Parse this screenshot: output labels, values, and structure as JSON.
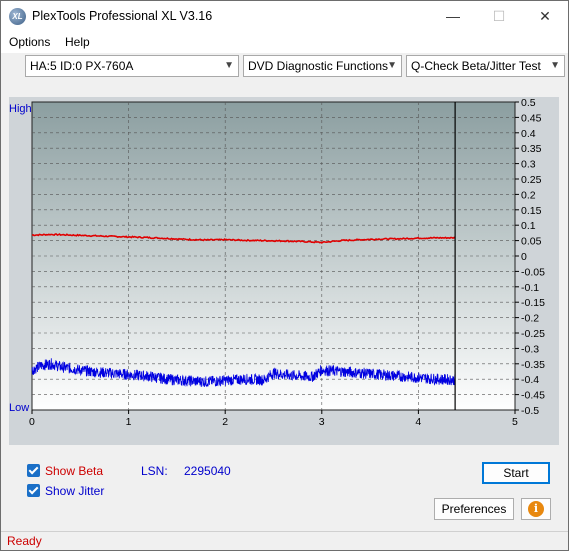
{
  "window": {
    "title": "PlexTools Professional XL V3.16",
    "icon_text": "XL"
  },
  "menu": {
    "options": "Options",
    "help": "Help"
  },
  "toolbar": {
    "drive": "HA:5 ID:0  PX-760A",
    "function": "DVD Diagnostic Functions",
    "test": "Q-Check Beta/Jitter Test"
  },
  "chart_data": {
    "type": "line",
    "y_axis_left_top": "High",
    "y_axis_left_bottom": "Low",
    "x_ticks": [
      "0",
      "1",
      "2",
      "3",
      "4",
      "5"
    ],
    "xlim": [
      0,
      5
    ],
    "y_ticks": [
      "0.5",
      "0.45",
      "0.4",
      "0.35",
      "0.3",
      "0.25",
      "0.2",
      "0.15",
      "0.1",
      "0.05",
      "0",
      "-0.05",
      "-0.1",
      "-0.15",
      "-0.2",
      "-0.25",
      "-0.3",
      "-0.35",
      "-0.4",
      "-0.45",
      "-0.5"
    ],
    "ylim": [
      -0.5,
      0.5
    ],
    "end_marker_x": 4.38,
    "grid": true,
    "colors": {
      "beta": "#e00000",
      "jitter": "#0000e0"
    },
    "series": [
      {
        "key": "beta",
        "color": "#e00000",
        "x": [
          0,
          0.2,
          0.4,
          0.6,
          0.8,
          1.0,
          1.2,
          1.4,
          1.6,
          1.8,
          2.0,
          2.2,
          2.4,
          2.6,
          2.8,
          3.0,
          3.2,
          3.4,
          3.6,
          3.8,
          4.0,
          4.2,
          4.38
        ],
        "y": [
          0.068,
          0.07,
          0.068,
          0.066,
          0.064,
          0.062,
          0.06,
          0.057,
          0.054,
          0.052,
          0.053,
          0.051,
          0.05,
          0.049,
          0.047,
          0.044,
          0.05,
          0.053,
          0.055,
          0.056,
          0.058,
          0.059,
          0.059
        ]
      },
      {
        "key": "jitter",
        "color": "#0000e0",
        "x": [
          0,
          0.1,
          0.2,
          0.3,
          0.4,
          0.5,
          0.6,
          0.8,
          1.0,
          1.2,
          1.4,
          1.6,
          1.8,
          2.0,
          2.2,
          2.4,
          2.5,
          2.6,
          2.8,
          2.9,
          3.0,
          3.2,
          3.4,
          3.6,
          3.8,
          4.0,
          4.2,
          4.38
        ],
        "y": [
          -0.37,
          -0.355,
          -0.35,
          -0.36,
          -0.365,
          -0.37,
          -0.375,
          -0.38,
          -0.385,
          -0.39,
          -0.4,
          -0.405,
          -0.408,
          -0.404,
          -0.4,
          -0.402,
          -0.38,
          -0.385,
          -0.39,
          -0.392,
          -0.37,
          -0.375,
          -0.38,
          -0.385,
          -0.39,
          -0.395,
          -0.4,
          -0.402
        ]
      }
    ]
  },
  "controls": {
    "show_beta_label": "Show Beta",
    "show_jitter_label": "Show Jitter",
    "lsn_label": "LSN:",
    "lsn_value": "2295040",
    "start_button": "Start",
    "preferences_button": "Preferences"
  },
  "status": {
    "text": "Ready"
  }
}
